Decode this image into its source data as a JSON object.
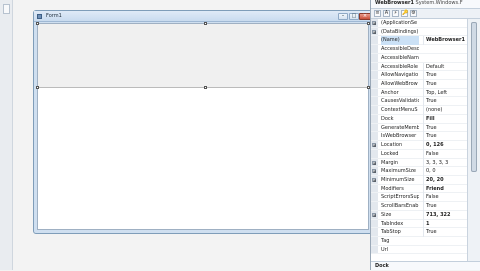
{
  "form": {
    "title": "Form1",
    "min_glyph": "–",
    "max_glyph": "□",
    "close_glyph": "×"
  },
  "properties": {
    "object_name": "WebBrowser1",
    "object_type": "System.Windows.F",
    "toolbar": [
      "≡",
      "A",
      "⚡",
      "🔑",
      "⚙"
    ],
    "rows": [
      {
        "exp": "⊞",
        "name": "(ApplicationSe",
        "value": ""
      },
      {
        "exp": "⊞",
        "name": "(DataBindings)",
        "value": ""
      },
      {
        "exp": "",
        "name": "(Name)",
        "value": "WebBrowser1",
        "bold": true
      },
      {
        "exp": "",
        "name": "AccessibleDesc",
        "value": ""
      },
      {
        "exp": "",
        "name": "AccessibleNam",
        "value": ""
      },
      {
        "exp": "",
        "name": "AccessibleRole",
        "value": "Default"
      },
      {
        "exp": "",
        "name": "AllowNavigatio",
        "value": "True"
      },
      {
        "exp": "",
        "name": "AllowWebBrow",
        "value": "True"
      },
      {
        "exp": "",
        "name": "Anchor",
        "value": "Top, Left"
      },
      {
        "exp": "",
        "name": "CausesValidatio",
        "value": "True"
      },
      {
        "exp": "",
        "name": "ContextMenuS",
        "value": "(none)"
      },
      {
        "exp": "",
        "name": "Dock",
        "value": "Fill",
        "bold": true
      },
      {
        "exp": "",
        "name": "GenerateMemb",
        "value": "True"
      },
      {
        "exp": "",
        "name": "IsWebBrowser",
        "value": "True"
      },
      {
        "exp": "⊞",
        "name": "Location",
        "value": "0, 126",
        "bold": true
      },
      {
        "exp": "",
        "name": "Locked",
        "value": "False"
      },
      {
        "exp": "⊞",
        "name": "Margin",
        "value": "3, 3, 3, 3"
      },
      {
        "exp": "⊞",
        "name": "MaximumSize",
        "value": "0, 0"
      },
      {
        "exp": "⊞",
        "name": "MinimumSize",
        "value": "20, 20",
        "bold": true
      },
      {
        "exp": "",
        "name": "Modifiers",
        "value": "Friend",
        "bold": true
      },
      {
        "exp": "",
        "name": "ScriptErrorsSup",
        "value": "False"
      },
      {
        "exp": "",
        "name": "ScrollBarsEnab",
        "value": "True"
      },
      {
        "exp": "⊞",
        "name": "Size",
        "value": "713, 322",
        "bold": true
      },
      {
        "exp": "",
        "name": "TabIndex",
        "value": "1",
        "bold": true
      },
      {
        "exp": "",
        "name": "TabStop",
        "value": "True"
      },
      {
        "exp": "",
        "name": "Tag",
        "value": ""
      },
      {
        "exp": "",
        "name": "Url",
        "value": ""
      }
    ],
    "footer": "Dock"
  }
}
